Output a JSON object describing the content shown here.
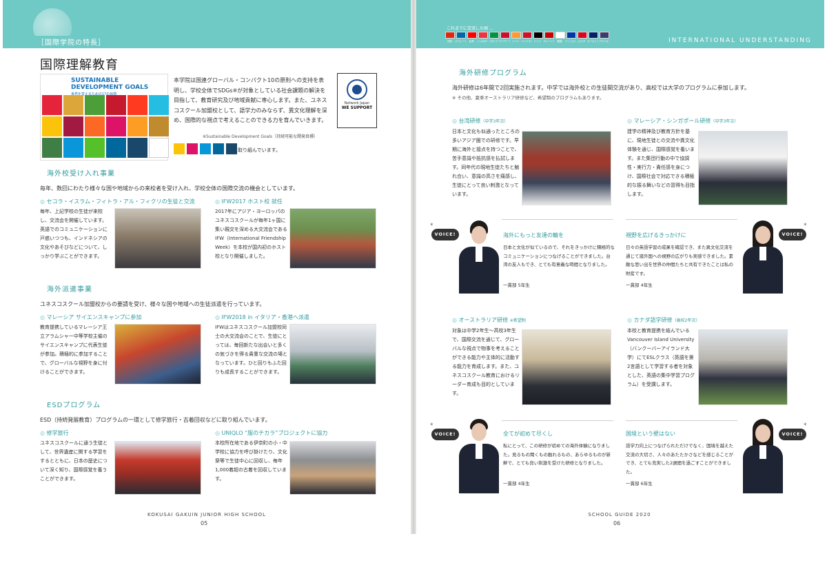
{
  "left": {
    "section_tag": "［国際学院の特長］",
    "title": "国際理解教育",
    "sdg_box": {
      "title": "SUSTAINABLE DEVELOPMENT GOALS",
      "subtitle": "世界を変えるための17の目標"
    },
    "intro": "本学院は国連グローバル・コンパクト10の原則への支持を表明し、学校全体でSDGs※が対象としている社会課題の解決を目指して、教育研究及び地域貢献に専心します。また、ユネスコスクール加盟校として、語学力のみならず、異文化理解を深め、国際的な視点で考えることのできる力を育んでいきます。",
    "sdg_note": "※Sustainable Development Goals（持続可能な開発目標）",
    "sdg_mini_text": "に取り組んでいます。",
    "ungc": {
      "line1": "Network Japan",
      "line2": "WE SUPPORT"
    },
    "inbound": {
      "heading": "海外校受け入れ事業",
      "desc": "毎年、数回にわたり様々な国や地域からの来校者を受け入れ、学校全体の国際交流の機会としています。",
      "items": [
        {
          "title": "セコラ・イスラム・フィトラ・アル・フィクリの生徒と交流",
          "text": "毎年、上記学校の生徒が来校し、交流会を開催しています。英語でのコミュニケーションに戸惑いつつも、インドネシアの文化やあそびなどについて、しっかり学ぶことができます。"
        },
        {
          "title": "IFW2017 ホスト校 就任",
          "text": "2017年にアジア・ヨーロッパのユネスコスクールが毎年1ヶ国に集い親交を深める大交流会であるIFW（International Friendship Week）を本校が国内初のホスト校となり開催しました。"
        }
      ]
    },
    "outbound": {
      "heading": "海外派遣事業",
      "desc": "ユネスコスクール加盟校からの要請を受け、様々な国や地域への生徒派遣を行っています。",
      "items": [
        {
          "title": "マレーシア サイエンスキャンプに参加",
          "text": "教育提携しているマレーシア王立アラムシャー中等学校主催のサイエンスキャンプに代表生徒が参加。積極的に参加することで、グローバルな視野を身に付けることができます。"
        },
        {
          "title": "IFW2018 in イタリア・香港へ派遣",
          "text": "IFWはユネスコスクール加盟校同士の大交流会のことで、生徒にとっては、毎回新たな出会いと多くの気づきを得る貴重な交流の場となっています。ひと回りもふた回りも成長することができます。"
        }
      ]
    },
    "esd": {
      "heading": "ESDプログラム",
      "desc": "ESD（持続発展教育）プログラムの一環として修学旅行・古着回収などに取り組んでいます。",
      "items": [
        {
          "title": "修学旅行",
          "text": "ユネスコスクールに通う生徒として、世界遺産に関する学習をするとともに、日本の歴史について深く知り、国際感覚を養うことができます。"
        },
        {
          "title": "UNIQLO “服のチカラ”プロジェクトに協力",
          "text": "本校所在地である伊奈町の小・中学校に協力を呼び掛けたり、文化祭等で生徒中心に回収し、毎年1,000着超の古着を回収しています。"
        }
      ]
    },
    "footer": "KOKUSAI GAKUIN JUNIOR HIGH SCHOOL",
    "page_number": "05"
  },
  "right": {
    "flags_title": "これまでに交流した国 …",
    "flag_labels": [
      "中国",
      "スウェーデン",
      "台湾",
      "シンガポール",
      "イタリア",
      "デンマーク",
      "インド",
      "インドネシア",
      "ドイツ",
      "マレーシア",
      "韓国",
      "フィリピン",
      "カナダ",
      "オーストラリア",
      "アメリカ"
    ],
    "header_en": "INTERNATIONAL UNDERSTANDING",
    "program": {
      "heading": "海外研修プログラム",
      "desc": "海外研修は6年間で2回実施されます。中学では海外校との生徒間交流があり、高校では大学のプログラムに参加します。",
      "note": "※ その他、夏季オーストラリア研修など、希望制のプログラムもあります。"
    },
    "cards": [
      {
        "title": "台湾研修",
        "tag": "（中学3年次）",
        "text": "日本と文化も似通ったところの多いアジア圏での研修です。早期に海外と接点を持つことで、苦手意識や抵抗感を払拭します。同年代の現地生徒たちと触れ合い、意識の高さを痛感し、生徒にとって良い刺激となっています。"
      },
      {
        "title": "マレーシア・シンガポール研修",
        "tag": "（中学3年次）",
        "text": "建学の精神及び教育方針を基に、現地生徒との交流や異文化体験を通じ、国際感覚を養います。また集団行動の中で協調性・実行力・責任感を身につけ、国際社会で対応できる積極的な振る舞いなどの習得も目指します。"
      },
      {
        "title": "オーストラリア研修",
        "tag": "※希望制",
        "text": "対象は中学2年生～高校3年生で、国際交流を通じて、グローバルな視点で物事を考えることができる能力や主体的に活動する能力を育成します。また、ユネスコスクール教育におけるリーダー育成も目的としています。"
      },
      {
        "title": "カナダ語学研修",
        "tag": "（高校2年次）",
        "text": "本校と教育提携を結んでいるVancouver Island University（バンクーバーアイランド大学）にてESLクラス（英語を第2言語として学習する者を対象とした、英語の集中学習プログラム）を受講します。"
      }
    ],
    "voices": [
      {
        "label": "VOICE!",
        "title": "海外にもっと友達の輪を",
        "text": "日本と文化が似ているので、それをきっかけに積極的なコミュニケーションにつなげることができました。台湾の友人もでき、とても有意義な時間となりました。",
        "grade": "一貫部 5年生"
      },
      {
        "label": "VOICE!",
        "title": "視野を広げるきっかけに",
        "text": "日々の英語学習の成果を確認でき、また異文化交流を通じて諸外国への視野の広がりも実感できました。素敵な思い出を世界の仲間たちと共有できたことは私の財産です。",
        "grade": "一貫部 4年生"
      },
      {
        "label": "VOICE!",
        "title": "全てが初めて尽くし",
        "text": "私にとって、この研修が初めての海外体験になりました。見るもの聞くもの触れるもの、あらゆるものが新鮮で、とても良い刺激を受けた研修となりました。",
        "grade": "一貫部 4年生"
      },
      {
        "label": "VOICE!",
        "title": "国境という壁はない",
        "text": "語学力向上につなげられただけでなく、国境を越えた交流の大切さ、人々のあたたかさなどを感じることができ、とても充実した2週間を過ごすことができました。",
        "grade": "一貫部 6年生"
      }
    ],
    "footer": "SCHOOL GUIDE 2020",
    "page_number": "06"
  },
  "colors": {
    "accent": "#6fc9c5",
    "heading": "#2f9a9d"
  },
  "sdg_colors": [
    "#e5243b",
    "#dda63a",
    "#4c9f38",
    "#c5192d",
    "#ff3a21",
    "#26bde2",
    "#fcc30b",
    "#a21942",
    "#fd6925",
    "#dd1367",
    "#fd9d24",
    "#bf8b2e",
    "#3f7e44",
    "#0a97d9",
    "#56c02b",
    "#00689d",
    "#19486a",
    "#ffffff"
  ],
  "flag_colors": [
    "#de2910",
    "#006aa7",
    "#fe0000",
    "#ef3340",
    "#009246",
    "#c8102e",
    "#ff9933",
    "#ce1126",
    "#000000",
    "#cc0001",
    "#ffffff",
    "#0038a8",
    "#d80621",
    "#012169",
    "#3c3b6e"
  ]
}
